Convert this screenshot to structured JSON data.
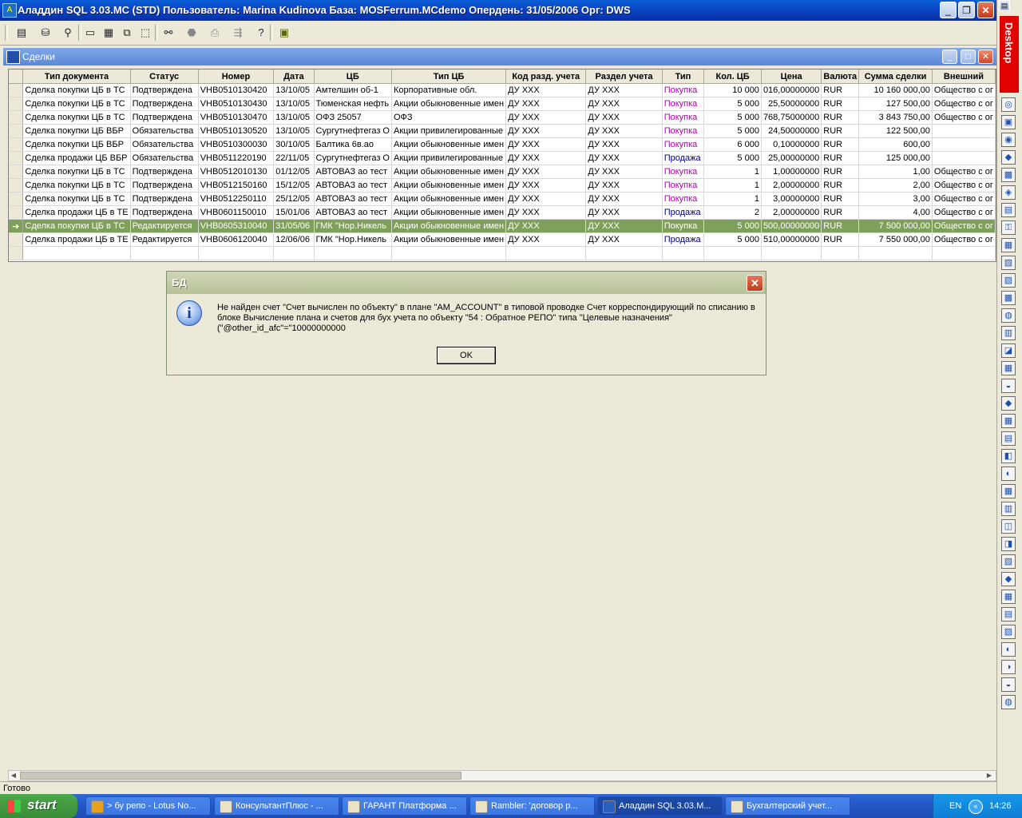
{
  "window": {
    "title": "Аладдин SQL 3.03.MC (STD)  Пользователь: Marina Kudinova База: MOSFerrum.MCdemo Опердень: 31/05/2006 Орг: DWS",
    "minimize": "_",
    "restore": "❐",
    "close": "✕"
  },
  "toolbar": {
    "icons": [
      "list-icon",
      "database-icon",
      "find-user-icon",
      "window-icon",
      "tile-icon",
      "cascade-icon",
      "arrange-icon",
      "binoculars-icon",
      "stop-icon",
      "print-icon",
      "export-icon",
      "help-icon",
      "module-icon"
    ]
  },
  "mdi": {
    "title": "Сделки",
    "min": "_",
    "max": "□",
    "close": "✕"
  },
  "grid": {
    "columns": [
      "Тип документа",
      "Статус",
      "Номер",
      "Дата",
      "ЦБ",
      "Тип ЦБ",
      "Код разд. учета",
      "Раздел учета",
      "Тип",
      "Кол. ЦБ",
      "Цена",
      "Валюта",
      "Сумма сделки",
      "Внешний"
    ],
    "rows": [
      [
        "Сделка покупки ЦБ в ТС",
        "Подтверждена",
        "VHB0510130420",
        "13/10/05",
        "Амтелшин об-1",
        "Корпоративные обл.",
        "ДУ ХХХ",
        "ДУ ХХХ",
        "Покупка",
        "10 000",
        "016,00000000",
        "RUR",
        "10 160 000,00",
        "Общество с ог"
      ],
      [
        "Сделка покупки ЦБ в ТС",
        "Подтверждена",
        "VHB0510130430",
        "13/10/05",
        "Тюменская нефть",
        "Акции обыкновенные имен",
        "ДУ ХХХ",
        "ДУ ХХХ",
        "Покупка",
        "5 000",
        "25,50000000",
        "RUR",
        "127 500,00",
        "Общество с ог"
      ],
      [
        "Сделка покупки ЦБ в ТС",
        "Подтверждена",
        "VHB0510130470",
        "13/10/05",
        "ОФЗ 25057",
        "ОФЗ",
        "ДУ ХХХ",
        "ДУ ХХХ",
        "Покупка",
        "5 000",
        "768,75000000",
        "RUR",
        "3 843 750,00",
        "Общество с ог"
      ],
      [
        "Сделка покупки ЦБ ВБР",
        "Обязательства",
        "VHB0510130520",
        "13/10/05",
        "Сургутнефтегаз О",
        "Акции привилегированные",
        "ДУ ХХХ",
        "ДУ ХХХ",
        "Покупка",
        "5 000",
        "24,50000000",
        "RUR",
        "122 500,00",
        ""
      ],
      [
        "Сделка покупки ЦБ ВБР",
        "Обязательства",
        "VHB0510300030",
        "30/10/05",
        " Балтика 6в.ао",
        "Акции обыкновенные имен",
        "ДУ ХХХ",
        "ДУ ХХХ",
        "Покупка",
        "6 000",
        "0,10000000",
        "RUR",
        "600,00",
        ""
      ],
      [
        "Сделка продажи ЦБ ВБР",
        "Обязательства",
        "VHB0511220190",
        "22/11/05",
        "Сургутнефтегаз О",
        "Акции привилегированные",
        "ДУ ХХХ",
        "ДУ ХХХ",
        "Продажа",
        "5 000",
        "25,00000000",
        "RUR",
        "125 000,00",
        ""
      ],
      [
        "Сделка покупки ЦБ в ТС",
        "Подтверждена",
        "VHB0512010130",
        "01/12/05",
        "АВТОВАЗ ао тест",
        "Акции обыкновенные имен",
        "ДУ ХХХ",
        "ДУ ХХХ",
        "Покупка",
        "1",
        "1,00000000",
        "RUR",
        "1,00",
        "Общество с ог"
      ],
      [
        "Сделка покупки ЦБ в ТС",
        "Подтверждена",
        "VHB0512150160",
        "15/12/05",
        "АВТОВАЗ ао тест",
        "Акции обыкновенные имен",
        "ДУ ХХХ",
        "ДУ ХХХ",
        "Покупка",
        "1",
        "2,00000000",
        "RUR",
        "2,00",
        "Общество с ог"
      ],
      [
        "Сделка покупки ЦБ в ТС",
        "Подтверждена",
        "VHB0512250110",
        "25/12/05",
        "АВТОВАЗ ао тест",
        "Акции обыкновенные имен",
        "ДУ ХХХ",
        "ДУ ХХХ",
        "Покупка",
        "1",
        "3,00000000",
        "RUR",
        "3,00",
        "Общество с ог"
      ],
      [
        "Сделка продажи ЦБ в ТЕ",
        "Подтверждена",
        "VHB0601150010",
        "15/01/06",
        "АВТОВАЗ ао тест",
        "Акции обыкновенные имен",
        "ДУ ХХХ",
        "ДУ ХХХ",
        "Продажа",
        "2",
        "2,00000000",
        "RUR",
        "4,00",
        "Общество с ог"
      ],
      [
        "Сделка покупки ЦБ в ТС",
        "Редактируется",
        "VHB0605310040",
        "31/05/06",
        "ГМК \"Нор.Никель",
        "Акции обыкновенные имен",
        "ДУ ХХХ",
        "ДУ ХХХ",
        "Покупка",
        "5 000",
        "500,00000000",
        "RUR",
        "7 500 000,00",
        "Общество с ог"
      ],
      [
        "Сделка продажи ЦБ в ТЕ",
        "Редактируется",
        "VHB0606120040",
        "12/06/06",
        "ГМК \"Нор.Никель",
        "Акции обыкновенные имен",
        "ДУ ХХХ",
        "ДУ ХХХ",
        "Продажа",
        "5 000",
        "510,00000000",
        "RUR",
        "7 550 000,00",
        "Общество с ог"
      ]
    ],
    "selected_row": 10,
    "row_indicator": "➔"
  },
  "dialog": {
    "title": "БД",
    "icon": "info-icon",
    "message_line1": "Не найден счет \"Счет вычислен по объекту\" в плане \"AM_ACCOUNT\" в типовой  проводке Счет корреспондирующий по списанию в",
    "message_line2": "блоке Вычисление плана и  счетов для бух учета по объекту \"54 : Обратное РЕПО\" типа \"Целевые назначения\"",
    "message_line3": "(\"@other_id_afc\"=\"10000000000",
    "ok_label": "OK",
    "close": "✕",
    "info_glyph": "i"
  },
  "sidebar": {
    "label": "Desktop"
  },
  "statusbar": {
    "text": "Готово"
  },
  "taskbar": {
    "start": "start",
    "tasks": [
      {
        "label": "> бу репо - Lotus No..."
      },
      {
        "label": "КонсультантПлюс - ..."
      },
      {
        "label": "ГАРАНТ Платформа ..."
      },
      {
        "label": "Rambler: 'договор р..."
      },
      {
        "label": "Аладдин SQL 3.03.M..."
      },
      {
        "label": "Бухгалтерский учет..."
      }
    ],
    "lang": "EN",
    "clock": "14:26",
    "tray_arrow": "«"
  }
}
